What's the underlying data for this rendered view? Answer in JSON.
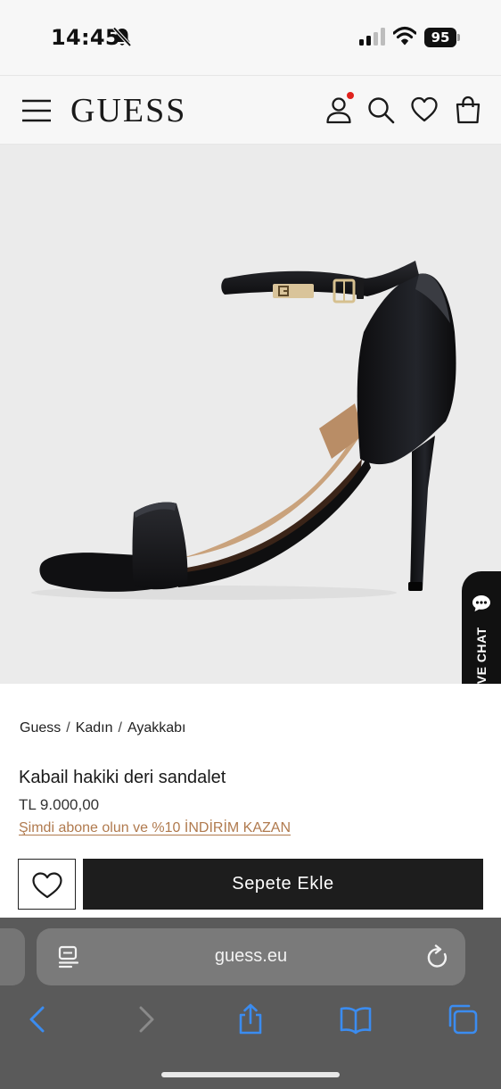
{
  "status_bar": {
    "time": "14:45",
    "battery": "95"
  },
  "header": {
    "logo": "GUESS",
    "icons": [
      "menu-icon",
      "account-icon",
      "search-icon",
      "heart-icon",
      "bag-icon"
    ],
    "notification_color": "#e0221d"
  },
  "product_image": {
    "live_chat_label": "LIVE CHAT"
  },
  "breadcrumb": {
    "items": [
      "Guess",
      "Kadın",
      "Ayakkabı"
    ],
    "separator": "/"
  },
  "product": {
    "title": "Kabail hakiki deri sandalet",
    "price": "TL 9.000,00",
    "promo": "Şimdi abone olun ve %10 İNDİRİM KAZAN",
    "add_to_cart": "Sepete Ekle"
  },
  "browser": {
    "url": "guess.eu",
    "toolbar": [
      "back-icon",
      "forward-icon",
      "share-icon",
      "bookmarks-icon",
      "tabs-icon"
    ]
  },
  "colors": {
    "accent_link": "#b07a4e",
    "button_dark": "#1d1d1d",
    "safari_blue": "#3b8cf0"
  }
}
